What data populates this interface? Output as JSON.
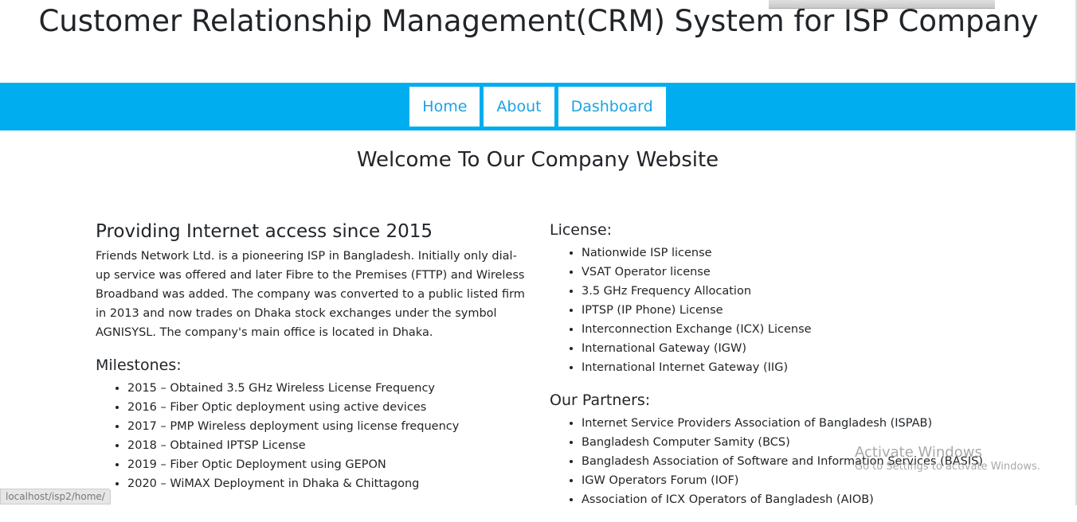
{
  "header": {
    "title": "Customer Relationship Management(CRM) System for ISP Company"
  },
  "nav": {
    "items": [
      "Home",
      "About",
      "Dashboard"
    ],
    "color": "#00aeef"
  },
  "welcome": "Welcome To Our Company Website",
  "intro": {
    "heading": "Providing Internet access since 2015",
    "text": "Friends Network Ltd. is a pioneering ISP in Bangladesh. Initially only dial-up service was offered and later Fibre to the Premises (FTTP) and Wireless Broadband was added. The company was converted to a public listed firm in 2013 and now trades on Dhaka stock exchanges under the symbol AGNISYSL. The company's main office is located in Dhaka."
  },
  "milestones": {
    "heading": "Milestones:",
    "items": [
      "2015 – Obtained 3.5 GHz Wireless License Frequency",
      "2016 – Fiber Optic deployment using active devices",
      "2017 – PMP Wireless deployment using license frequency",
      "2018 – Obtained IPTSP License",
      "2019 – Fiber Optic Deployment using GEPON",
      "2020 – WiMAX Deployment in Dhaka & Chittagong"
    ]
  },
  "license": {
    "heading": "License:",
    "items": [
      "Nationwide ISP license",
      "VSAT Operator license",
      "3.5 GHz Frequency Allocation",
      "IPTSP (IP Phone) License",
      "Interconnection Exchange (ICX) License",
      "International Gateway (IGW)",
      "International Internet Gateway (IIG)"
    ]
  },
  "partners": {
    "heading": "Our Partners:",
    "items": [
      "Internet Service Providers Association of Bangladesh (ISPAB)",
      "Bangladesh Computer Samity (BCS)",
      "Bangladesh Association of Software and Information Services (BASIS)",
      "IGW Operators Forum (IOF)",
      "Association of ICX Operators of Bangladesh (AIOB)"
    ]
  },
  "status_url": "localhost/isp2/home/",
  "watermark": {
    "line1": "Activate Windows",
    "line2": "Go to Settings to activate Windows."
  }
}
